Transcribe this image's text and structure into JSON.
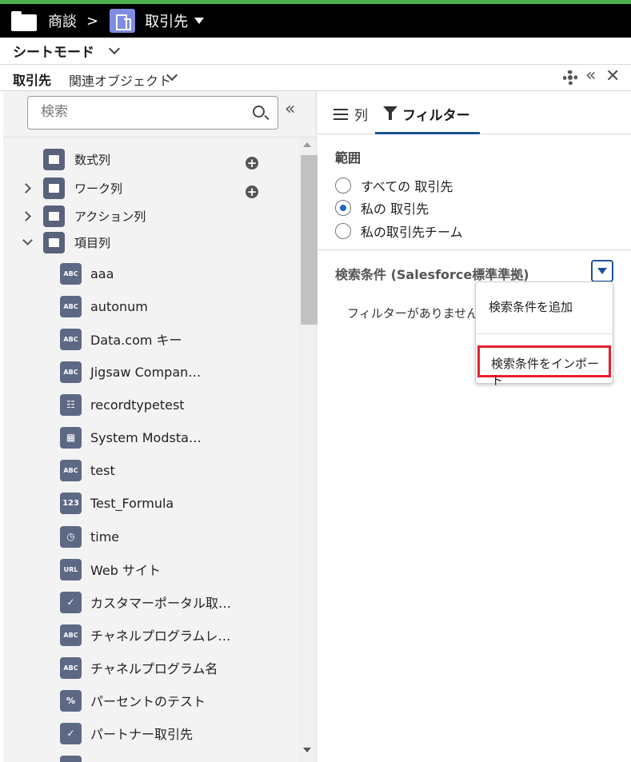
{
  "topbar": {
    "crumb": "商談",
    "separator": ">",
    "object_title": "取引先"
  },
  "sheet_mode": {
    "label": "シートモード"
  },
  "tabs": {
    "main": "取引先",
    "related": "関連オブジェクト"
  },
  "left": {
    "search_placeholder": "検索",
    "tree": [
      {
        "label": "数式列"
      },
      {
        "label": "ワーク列"
      },
      {
        "label": "アクション列"
      },
      {
        "label": "項目列"
      }
    ],
    "fields": [
      {
        "icon": "ABC",
        "label": "aaa"
      },
      {
        "icon": "ABC",
        "label": "autonum"
      },
      {
        "icon": "ABC",
        "label": "Data.com キー"
      },
      {
        "icon": "ABC",
        "label": "Jigsaw Compan…"
      },
      {
        "icon": "list-check-icon",
        "label": "recordtypetest"
      },
      {
        "icon": "calendar-icon",
        "label": "System Modsta…"
      },
      {
        "icon": "ABC",
        "label": "test"
      },
      {
        "icon": "123",
        "label": "Test_Formula"
      },
      {
        "icon": "clock-icon",
        "label": "time"
      },
      {
        "icon": "URL",
        "label": "Web サイト"
      },
      {
        "icon": "checkbox-icon",
        "label": "カスタマーポータル取…"
      },
      {
        "icon": "ABC",
        "label": "チャネルプログラムレ…"
      },
      {
        "icon": "ABC",
        "label": "チャネルプログラム名"
      },
      {
        "icon": "%",
        "label": "パーセントのテスト"
      },
      {
        "icon": "checkbox-icon",
        "label": "パートナー取引先"
      }
    ]
  },
  "right": {
    "tab_columns": "列",
    "tab_filter": "フィルター",
    "scope_title": "範囲",
    "scope_options": [
      "すべての 取引先",
      "私の 取引先",
      "私の取引先チーム"
    ],
    "scope_selected": "私の 取引先",
    "conditions_title": "検索条件 (Salesforce標準準拠)",
    "no_filter_text": "フィルターがありません。",
    "menu": {
      "add": "検索条件を追加",
      "import": "検索条件をインポート"
    }
  },
  "colors": {
    "accent": "#1b5297",
    "highlight": "#e5202e",
    "topbar": "#000000",
    "top_accent_line": "#4caf50",
    "object_icon": "#7f8de1"
  }
}
